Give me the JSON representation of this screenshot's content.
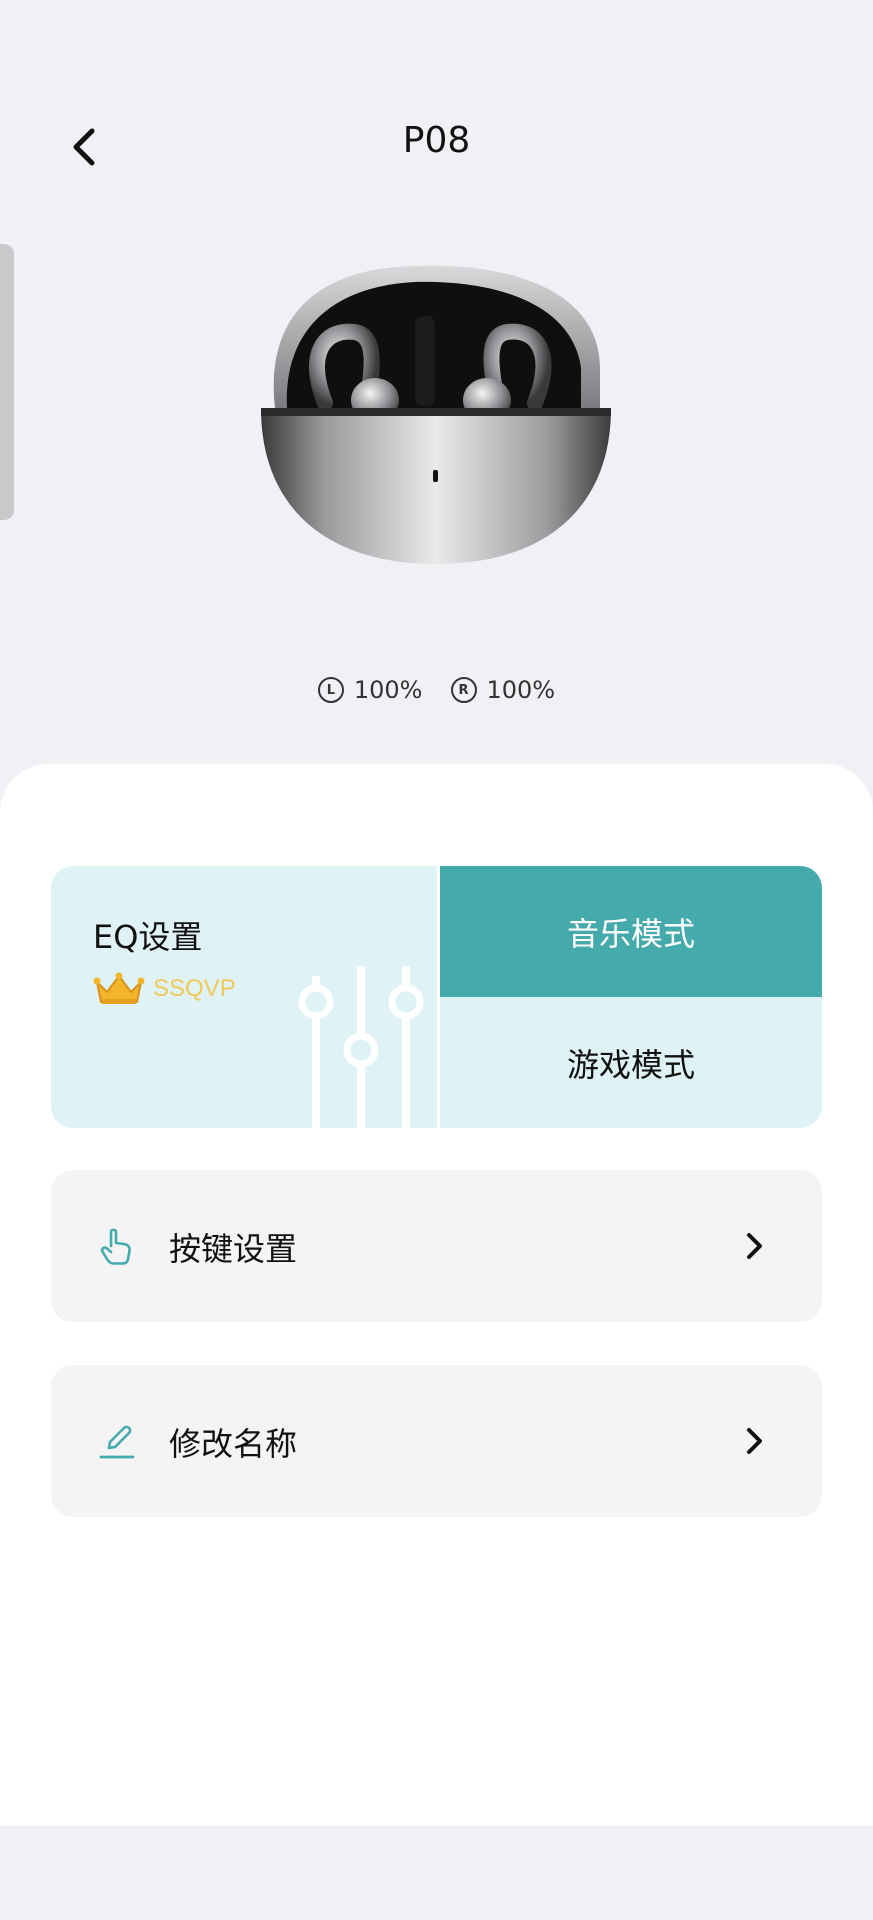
{
  "header": {
    "title": "P08"
  },
  "battery": {
    "left": {
      "badge": "L",
      "value": "100%"
    },
    "right": {
      "badge": "R",
      "value": "100%"
    }
  },
  "eq": {
    "title": "EQ设置",
    "vip_label": "SSQVP",
    "modes": [
      {
        "label": "音乐模式",
        "active": true
      },
      {
        "label": "游戏模式",
        "active": false
      }
    ]
  },
  "rows": [
    {
      "label": "按键设置",
      "icon": "hand-pointer-icon"
    },
    {
      "label": "修改名称",
      "icon": "pencil-edit-icon"
    }
  ],
  "colors": {
    "accent": "#44aaab",
    "eq_bg": "#dff2f5",
    "vip_gold": "#f1c85a",
    "page_bg": "#f1f0f5"
  }
}
